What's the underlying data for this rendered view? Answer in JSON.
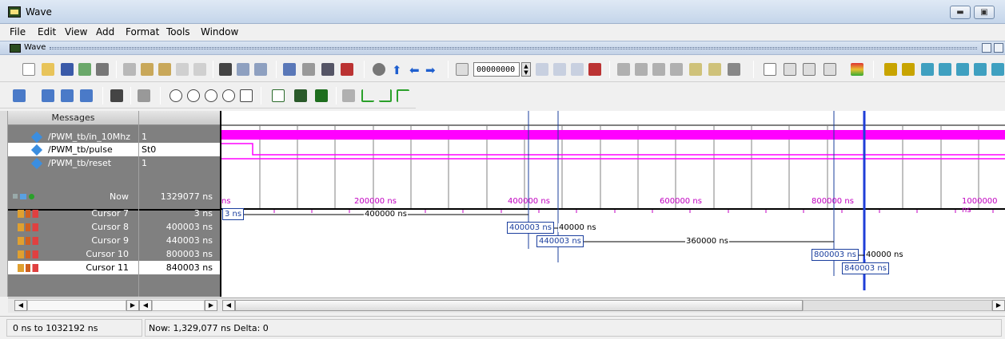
{
  "window": {
    "title": "Wave"
  },
  "menu": [
    "File",
    "Edit",
    "View",
    "Add",
    "Format",
    "Tools",
    "Window"
  ],
  "wave_strip": {
    "title": "Wave"
  },
  "toolbar": {
    "time_value": "00000000"
  },
  "panes": {
    "messages_header": "Messages"
  },
  "signals": [
    {
      "name": "/PWM_tb/in_10Mhz",
      "value": "1"
    },
    {
      "name": "/PWM_tb/pulse",
      "value": "St0"
    },
    {
      "name": "/PWM_tb/reset",
      "value": "1"
    }
  ],
  "now": {
    "label": "Now",
    "value": "1329077 ns"
  },
  "cursors": [
    {
      "label": "Cursor 7",
      "value": "3 ns",
      "tag": "3 ns",
      "delta": "400000 ns"
    },
    {
      "label": "Cursor 8",
      "value": "400003 ns",
      "tag": "400003 ns",
      "delta": "40000 ns"
    },
    {
      "label": "Cursor 9",
      "value": "440003 ns",
      "tag": "440003 ns",
      "delta": "360000 ns"
    },
    {
      "label": "Cursor 10",
      "value": "800003 ns",
      "tag": "800003 ns",
      "delta": "40000 ns"
    },
    {
      "label": "Cursor 11",
      "value": "840003 ns",
      "tag": "840003 ns"
    }
  ],
  "timeline": {
    "ticks": [
      "ns",
      "200000 ns",
      "400000 ns",
      "600000 ns",
      "800000 ns",
      "1000000 ns"
    ]
  },
  "status": {
    "range": "0 ns to 1032192 ns",
    "now": "Now: 1,329,077 ns  Delta: 0"
  },
  "colors": {
    "wave": "#ff00ff",
    "cursor": "#1b3f9e"
  }
}
